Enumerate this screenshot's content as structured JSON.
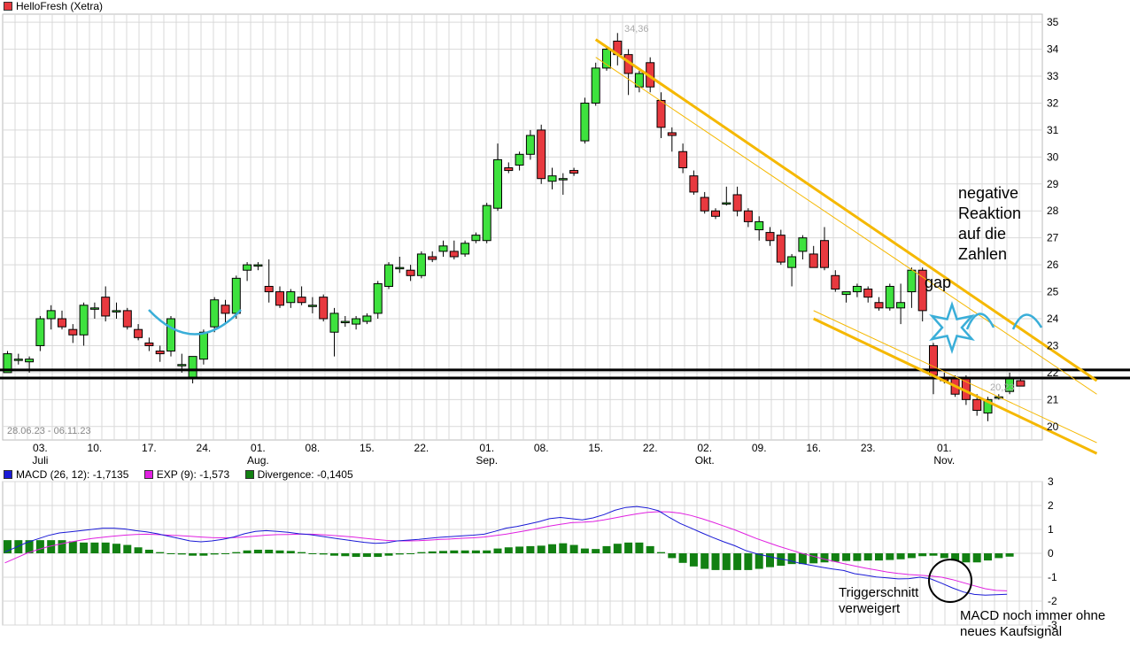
{
  "price_legend": {
    "label": "HelloFresh (Xetra)",
    "color": "#e8393f"
  },
  "date_range": "28.06.23 - 06.11.23",
  "high_label": "34,36",
  "low_label": "20,23",
  "annotations": {
    "negative": [
      "negative",
      "Reaktion",
      "auf die",
      "Zahlen"
    ],
    "gap": "gap",
    "trigger": [
      "Triggerschnitt",
      "verweigert"
    ],
    "macd_note": [
      "MACD noch immer ohne",
      "neues Kaufsignal"
    ]
  },
  "macd_legend": [
    {
      "label": "MACD (26, 12): -1,7135",
      "color": "#1a1ad6"
    },
    {
      "label": "EXP (9): -1,573",
      "color": "#e020e0"
    },
    {
      "label": "Divergence: -0,1405",
      "color": "#128012"
    }
  ],
  "colors": {
    "up": "#3ee23e",
    "down": "#e8393f",
    "trend": "#f5b800",
    "arc": "#3aaed8",
    "macd": "#1a1ad6",
    "exp": "#e020e0",
    "div": "#128012",
    "grid": "#d9d9d9"
  },
  "chart_data": [
    {
      "type": "candlestick",
      "title": "HelloFresh (Xetra)",
      "y_ticks": [
        20,
        21,
        22,
        23,
        24,
        25,
        26,
        27,
        28,
        29,
        30,
        31,
        32,
        33,
        34,
        35
      ],
      "ylim": [
        19.5,
        35.3
      ],
      "x_ticks": [
        {
          "i": 3,
          "day": "03.",
          "month": "Juli"
        },
        {
          "i": 8,
          "day": "10.",
          "month": ""
        },
        {
          "i": 13,
          "day": "17.",
          "month": ""
        },
        {
          "i": 18,
          "day": "24.",
          "month": ""
        },
        {
          "i": 23,
          "day": "01.",
          "month": "Aug."
        },
        {
          "i": 28,
          "day": "08.",
          "month": ""
        },
        {
          "i": 33,
          "day": "15.",
          "month": ""
        },
        {
          "i": 38,
          "day": "22.",
          "month": ""
        },
        {
          "i": 44,
          "day": "01.",
          "month": "Sep."
        },
        {
          "i": 49,
          "day": "08.",
          "month": ""
        },
        {
          "i": 54,
          "day": "15.",
          "month": ""
        },
        {
          "i": 59,
          "day": "22.",
          "month": ""
        },
        {
          "i": 64,
          "day": "02.",
          "month": "Okt."
        },
        {
          "i": 69,
          "day": "09.",
          "month": ""
        },
        {
          "i": 74,
          "day": "16.",
          "month": ""
        },
        {
          "i": 79,
          "day": "23.",
          "month": ""
        },
        {
          "i": 86,
          "day": "01.",
          "month": "Nov."
        }
      ],
      "candles": [
        [
          22.0,
          22.8,
          22.0,
          22.7
        ],
        [
          22.5,
          22.7,
          22.3,
          22.5
        ],
        [
          22.4,
          22.6,
          22.0,
          22.5
        ],
        [
          23.0,
          24.1,
          22.8,
          24.0
        ],
        [
          24.0,
          24.5,
          23.6,
          24.3
        ],
        [
          24.0,
          24.3,
          23.6,
          23.7
        ],
        [
          23.6,
          23.8,
          23.1,
          23.4
        ],
        [
          23.4,
          24.6,
          23.0,
          24.5
        ],
        [
          24.4,
          24.6,
          24.0,
          24.4
        ],
        [
          24.8,
          25.2,
          23.9,
          24.1
        ],
        [
          24.3,
          24.6,
          24.0,
          24.3
        ],
        [
          24.3,
          24.4,
          23.6,
          23.7
        ],
        [
          23.6,
          23.8,
          23.2,
          23.3
        ],
        [
          23.1,
          23.3,
          22.8,
          23.0
        ],
        [
          22.8,
          23.0,
          22.4,
          22.7
        ],
        [
          22.8,
          24.1,
          22.6,
          24.0
        ],
        [
          22.3,
          22.7,
          22.0,
          22.3
        ],
        [
          21.8,
          22.6,
          21.6,
          22.6
        ],
        [
          22.5,
          23.6,
          22.3,
          23.5
        ],
        [
          23.7,
          24.8,
          23.5,
          24.7
        ],
        [
          24.5,
          24.7,
          23.8,
          24.2
        ],
        [
          24.2,
          25.6,
          24.0,
          25.5
        ],
        [
          25.8,
          26.1,
          25.4,
          26.0
        ],
        [
          26.0,
          26.1,
          25.8,
          26.0
        ],
        [
          25.2,
          26.2,
          24.6,
          25.0
        ],
        [
          25.0,
          25.2,
          24.4,
          24.5
        ],
        [
          24.6,
          25.1,
          24.4,
          25.0
        ],
        [
          24.8,
          25.2,
          24.5,
          24.6
        ],
        [
          24.5,
          24.8,
          24.2,
          24.5
        ],
        [
          24.8,
          24.9,
          23.9,
          24.0
        ],
        [
          23.5,
          24.4,
          22.6,
          24.2
        ],
        [
          23.9,
          24.1,
          23.7,
          23.9
        ],
        [
          23.8,
          24.1,
          23.6,
          24.0
        ],
        [
          23.9,
          24.2,
          23.8,
          24.1
        ],
        [
          24.2,
          25.4,
          24.0,
          25.3
        ],
        [
          25.2,
          26.1,
          25.1,
          26.0
        ],
        [
          25.9,
          26.3,
          25.7,
          25.9
        ],
        [
          25.8,
          26.0,
          25.4,
          25.6
        ],
        [
          25.6,
          26.5,
          25.5,
          26.4
        ],
        [
          26.3,
          26.5,
          26.1,
          26.2
        ],
        [
          26.5,
          26.9,
          26.3,
          26.7
        ],
        [
          26.5,
          26.9,
          26.2,
          26.3
        ],
        [
          26.4,
          26.9,
          26.3,
          26.8
        ],
        [
          26.9,
          27.2,
          26.8,
          27.1
        ],
        [
          26.9,
          28.3,
          26.8,
          28.2
        ],
        [
          28.1,
          30.5,
          28.0,
          29.9
        ],
        [
          29.6,
          29.8,
          29.4,
          29.5
        ],
        [
          29.7,
          30.2,
          29.5,
          30.1
        ],
        [
          30.1,
          31.0,
          29.9,
          30.8
        ],
        [
          31.0,
          31.2,
          29.0,
          29.2
        ],
        [
          29.1,
          29.6,
          28.8,
          29.3
        ],
        [
          29.2,
          29.4,
          28.6,
          29.2
        ],
        [
          29.5,
          29.6,
          29.3,
          29.4
        ],
        [
          30.6,
          32.2,
          30.5,
          32.0
        ],
        [
          32.0,
          33.5,
          31.9,
          33.3
        ],
        [
          33.3,
          34.1,
          33.2,
          34.0
        ],
        [
          34.3,
          34.6,
          33.4,
          33.8
        ],
        [
          33.8,
          34.0,
          32.3,
          33.1
        ],
        [
          32.6,
          33.2,
          32.4,
          33.1
        ],
        [
          33.5,
          33.7,
          32.4,
          32.6
        ],
        [
          32.1,
          32.4,
          30.7,
          31.1
        ],
        [
          30.9,
          31.1,
          30.2,
          30.8
        ],
        [
          30.2,
          30.5,
          29.4,
          29.6
        ],
        [
          29.3,
          29.5,
          28.6,
          28.7
        ],
        [
          28.5,
          28.7,
          27.9,
          28.0
        ],
        [
          28.0,
          28.1,
          27.7,
          27.8
        ],
        [
          28.3,
          28.9,
          28.2,
          28.3
        ],
        [
          28.6,
          28.9,
          27.8,
          28.0
        ],
        [
          28.0,
          28.1,
          27.4,
          27.6
        ],
        [
          27.3,
          27.8,
          26.9,
          27.6
        ],
        [
          27.2,
          27.4,
          26.7,
          26.9
        ],
        [
          27.1,
          27.3,
          26.0,
          26.1
        ],
        [
          25.9,
          26.4,
          25.2,
          26.3
        ],
        [
          26.5,
          27.1,
          26.2,
          27.0
        ],
        [
          26.4,
          26.7,
          25.9,
          25.9
        ],
        [
          26.9,
          27.4,
          25.8,
          25.9
        ],
        [
          25.6,
          25.8,
          25.0,
          25.1
        ],
        [
          24.9,
          25.0,
          24.6,
          25.0
        ],
        [
          25.0,
          25.3,
          24.8,
          25.2
        ],
        [
          25.1,
          25.2,
          24.6,
          24.8
        ],
        [
          24.6,
          24.8,
          24.3,
          24.4
        ],
        [
          24.4,
          25.3,
          24.3,
          25.2
        ],
        [
          24.4,
          25.3,
          23.8,
          24.6
        ],
        [
          25.0,
          25.9,
          24.4,
          25.8
        ],
        [
          25.8,
          25.9,
          23.9,
          24.3
        ],
        [
          23.0,
          23.1,
          21.2,
          21.9
        ],
        [
          21.8,
          22.0,
          21.6,
          21.7
        ],
        [
          21.8,
          21.9,
          21.1,
          21.2
        ],
        [
          21.8,
          21.9,
          20.8,
          21.0
        ],
        [
          21.0,
          21.2,
          20.4,
          20.6
        ],
        [
          20.5,
          21.1,
          20.2,
          21.0
        ],
        [
          21.1,
          21.2,
          21.0,
          21.1
        ],
        [
          21.3,
          22.0,
          21.2,
          21.8
        ],
        [
          21.7,
          21.8,
          21.5,
          21.5
        ]
      ],
      "horizontal_lines": [
        22.1,
        21.8
      ],
      "trend_channel": {
        "upper": {
          "x": [
            54,
            100
          ],
          "y": [
            34.36,
            21.7
          ]
        },
        "upper_inner": {
          "x": [
            54,
            100
          ],
          "y": [
            33.7,
            21.2
          ]
        },
        "lower": {
          "x": [
            74,
            100
          ],
          "y": [
            24.0,
            19.0
          ]
        },
        "lower_inner": {
          "x": [
            74,
            100
          ],
          "y": [
            24.3,
            19.4
          ]
        }
      }
    },
    {
      "type": "macd",
      "y_ticks": [
        3,
        2,
        1,
        0,
        -1,
        -2,
        -3
      ],
      "ylim": [
        -3,
        3
      ],
      "series": [
        {
          "name": "MACD (26, 12)",
          "values": [
            0.05,
            0.25,
            0.45,
            0.6,
            0.75,
            0.85,
            0.9,
            0.95,
            1.0,
            1.05,
            1.05,
            1.02,
            0.95,
            0.9,
            0.82,
            0.72,
            0.62,
            0.52,
            0.48,
            0.52,
            0.58,
            0.68,
            0.82,
            0.92,
            0.95,
            0.92,
            0.88,
            0.82,
            0.78,
            0.72,
            0.65,
            0.58,
            0.52,
            0.46,
            0.42,
            0.44,
            0.52,
            0.55,
            0.58,
            0.63,
            0.67,
            0.7,
            0.73,
            0.76,
            0.8,
            0.92,
            1.05,
            1.12,
            1.22,
            1.32,
            1.45,
            1.5,
            1.45,
            1.4,
            1.48,
            1.62,
            1.8,
            1.92,
            1.96,
            1.9,
            1.78,
            1.5,
            1.25,
            1.05,
            0.85,
            0.66,
            0.48,
            0.32,
            0.12,
            -0.02,
            -0.12,
            -0.22,
            -0.3,
            -0.42,
            -0.5,
            -0.58,
            -0.66,
            -0.72,
            -0.85,
            -0.92,
            -0.99,
            -1.03,
            -1.07,
            -1.06,
            -1.0,
            -1.07,
            -1.25,
            -1.45,
            -1.62,
            -1.72,
            -1.75,
            -1.73,
            -1.71
          ]
        },
        {
          "name": "EXP (9)",
          "values": [
            -0.4,
            -0.2,
            0.0,
            0.15,
            0.28,
            0.38,
            0.47,
            0.55,
            0.62,
            0.67,
            0.72,
            0.76,
            0.79,
            0.8,
            0.78,
            0.76,
            0.74,
            0.71,
            0.68,
            0.66,
            0.65,
            0.66,
            0.68,
            0.72,
            0.76,
            0.78,
            0.79,
            0.8,
            0.8,
            0.78,
            0.75,
            0.72,
            0.68,
            0.63,
            0.58,
            0.54,
            0.52,
            0.52,
            0.53,
            0.55,
            0.58,
            0.6,
            0.63,
            0.65,
            0.68,
            0.74,
            0.8,
            0.88,
            0.96,
            1.05,
            1.14,
            1.21,
            1.28,
            1.3,
            1.33,
            1.4,
            1.48,
            1.57,
            1.65,
            1.71,
            1.74,
            1.73,
            1.68,
            1.58,
            1.45,
            1.3,
            1.14,
            0.98,
            0.8,
            0.62,
            0.46,
            0.3,
            0.16,
            0.02,
            -0.1,
            -0.22,
            -0.33,
            -0.43,
            -0.53,
            -0.62,
            -0.7,
            -0.78,
            -0.84,
            -0.89,
            -0.92,
            -0.95,
            -1.0,
            -1.1,
            -1.23,
            -1.36,
            -1.48,
            -1.55,
            -1.57
          ]
        },
        {
          "name": "Divergence",
          "values": [
            0.55,
            0.55,
            0.55,
            0.55,
            0.55,
            0.55,
            0.5,
            0.45,
            0.45,
            0.45,
            0.4,
            0.35,
            0.25,
            0.15,
            0.05,
            0.0,
            -0.05,
            -0.1,
            -0.1,
            -0.05,
            0.0,
            0.05,
            0.12,
            0.15,
            0.15,
            0.12,
            0.1,
            0.05,
            0.0,
            -0.05,
            -0.1,
            -0.12,
            -0.15,
            -0.15,
            -0.15,
            -0.1,
            -0.05,
            0.0,
            0.05,
            0.08,
            0.1,
            0.12,
            0.12,
            0.12,
            0.12,
            0.2,
            0.25,
            0.28,
            0.3,
            0.32,
            0.38,
            0.42,
            0.35,
            0.2,
            0.18,
            0.3,
            0.4,
            0.45,
            0.45,
            0.3,
            0.05,
            -0.2,
            -0.4,
            -0.55,
            -0.65,
            -0.7,
            -0.7,
            -0.7,
            -0.7,
            -0.65,
            -0.58,
            -0.52,
            -0.45,
            -0.45,
            -0.42,
            -0.38,
            -0.35,
            -0.32,
            -0.32,
            -0.3,
            -0.3,
            -0.28,
            -0.25,
            -0.2,
            -0.12,
            -0.1,
            -0.2,
            -0.3,
            -0.38,
            -0.38,
            -0.3,
            -0.2,
            -0.14
          ]
        }
      ]
    }
  ]
}
